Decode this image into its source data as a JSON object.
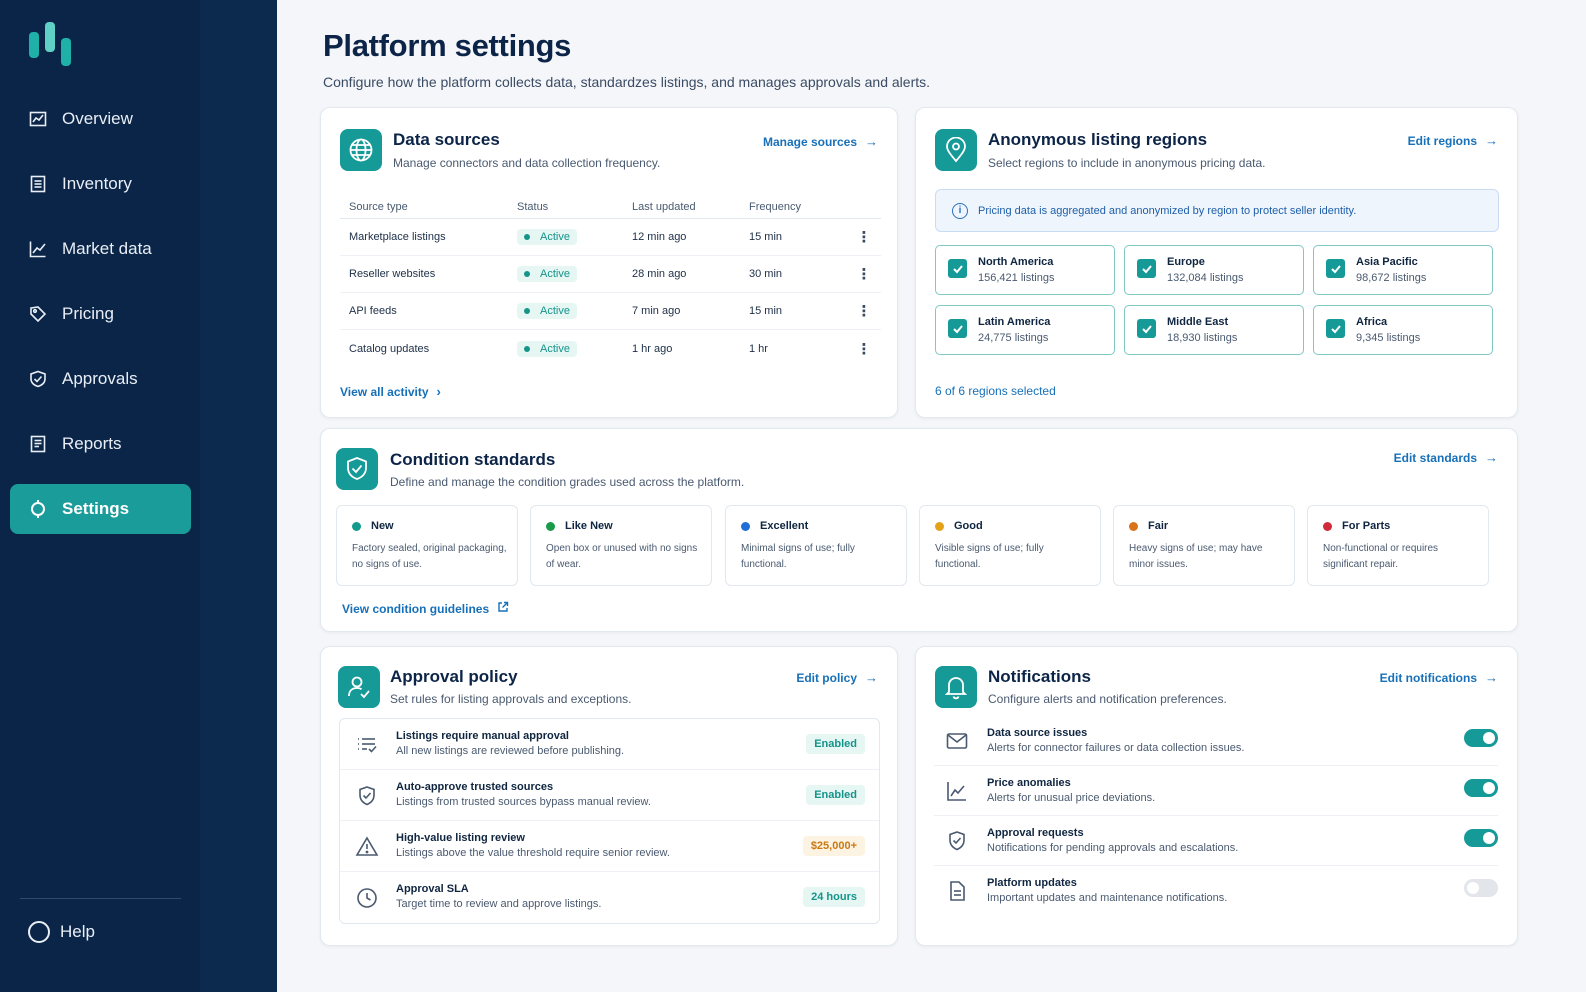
{
  "sidebar": {
    "items": [
      {
        "label": "Overview",
        "icon": "chart-icon"
      },
      {
        "label": "Inventory",
        "icon": "list-icon"
      },
      {
        "label": "Market data",
        "icon": "line-chart-icon"
      },
      {
        "label": "Pricing",
        "icon": "tag-icon"
      },
      {
        "label": "Approvals",
        "icon": "shield-check-icon"
      },
      {
        "label": "Reports",
        "icon": "document-icon"
      },
      {
        "label": "Settings",
        "icon": "gear-icon",
        "active": true
      }
    ],
    "help_label": "Help"
  },
  "page": {
    "title": "Platform settings",
    "subtitle": "Configure how the platform collects data, standardzes listings, and manages approvals and alerts."
  },
  "data_sources": {
    "title": "Data sources",
    "subtitle": "Manage connectors and data collection frequency.",
    "link": "Manage sources",
    "columns": [
      "Source type",
      "Status",
      "Last updated",
      "Frequency"
    ],
    "rows": [
      {
        "source": "Marketplace listings",
        "status": "Active",
        "updated": "12 min ago",
        "frequency": "15 min"
      },
      {
        "source": "Reseller websites",
        "status": "Active",
        "updated": "28 min ago",
        "frequency": "30 min"
      },
      {
        "source": "API feeds",
        "status": "Active",
        "updated": "7 min ago",
        "frequency": "15 min"
      },
      {
        "source": "Catalog updates",
        "status": "Active",
        "updated": "1 hr ago",
        "frequency": "1 hr"
      }
    ],
    "footer_link": "View all activity",
    "row_menu_glyph": "⋮"
  },
  "regions": {
    "title": "Anonymous listing regions",
    "subtitle": "Select regions to include in anonymous pricing data.",
    "link": "Edit regions",
    "info": "Pricing data is aggregated and anonymized by region to protect seller identity.",
    "items": [
      {
        "name": "North America",
        "count": "156,421 listings",
        "checked": true
      },
      {
        "name": "Europe",
        "count": "132,084 listings",
        "checked": true
      },
      {
        "name": "Asia Pacific",
        "count": "98,672 listings",
        "checked": true
      },
      {
        "name": "Latin America",
        "count": "24,775 listings",
        "checked": true
      },
      {
        "name": "Middle East",
        "count": "18,930 listings",
        "checked": true
      },
      {
        "name": "Africa",
        "count": "9,345 listings",
        "checked": true
      }
    ],
    "selected_text": "6 of 6 regions selected"
  },
  "conditions": {
    "title": "Condition standards",
    "subtitle": "Define and manage the condition grades used across the platform.",
    "link": "Edit standards",
    "items": [
      {
        "name": "New",
        "desc": "Factory sealed, original packaging, no signs of use.",
        "color": "#149a8a"
      },
      {
        "name": "Like New",
        "desc": "Open box or unused with no signs of wear.",
        "color": "#1b9a4a"
      },
      {
        "name": "Excellent",
        "desc": "Minimal signs of use; fully functional.",
        "color": "#1f6fd6"
      },
      {
        "name": "Good",
        "desc": "Visible signs of use; fully functional.",
        "color": "#e3a21a"
      },
      {
        "name": "Fair",
        "desc": "Heavy signs of use; may have minor issues.",
        "color": "#d9731a"
      },
      {
        "name": "For Parts",
        "desc": "Non-functional or requires significant repair.",
        "color": "#d12a3a"
      }
    ],
    "footer_link": "View condition guidelines"
  },
  "approval": {
    "title": "Approval policy",
    "subtitle": "Set rules for listing approvals and exceptions.",
    "link": "Edit policy",
    "items": [
      {
        "title": "Listings require manual approval",
        "desc": "All new listings are reviewed before publishing.",
        "badge": "Enabled",
        "icon": "checklist-icon"
      },
      {
        "title": "Auto-approve trusted sources",
        "desc": "Listings from trusted sources bypass manual review.",
        "badge": "Enabled",
        "icon": "shield-check-icon"
      },
      {
        "title": "High-value listing review",
        "desc": "Listings above the value threshold require senior review.",
        "badge": "$25,000+",
        "icon": "warning-icon"
      },
      {
        "title": "Approval SLA",
        "desc": "Target time to review and approve listings.",
        "badge": "24 hours",
        "icon": "clock-icon"
      }
    ]
  },
  "notifications": {
    "title": "Notifications",
    "subtitle": "Configure alerts and notification preferences.",
    "link": "Edit notifications",
    "items": [
      {
        "title": "Data source issues",
        "desc": "Alerts for connector failures or data collection issues.",
        "enabled": true,
        "icon": "mail-icon"
      },
      {
        "title": "Price anomalies",
        "desc": "Alerts for unusual price deviations.",
        "enabled": true,
        "icon": "line-chart-icon"
      },
      {
        "title": "Approval requests",
        "desc": "Notifications for pending approvals and escalations.",
        "enabled": true,
        "icon": "shield-check-icon"
      },
      {
        "title": "Platform updates",
        "desc": "Important updates and maintenance notifications.",
        "enabled": false,
        "icon": "document-icon"
      }
    ]
  },
  "colors": {
    "sidebar_bg": "#0a2547",
    "accent": "#159a98",
    "link": "#1770b8"
  }
}
